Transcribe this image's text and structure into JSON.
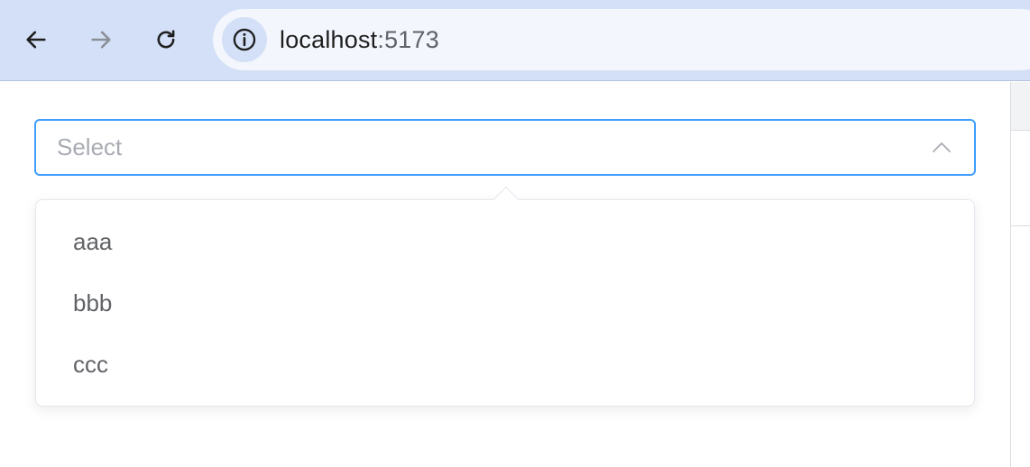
{
  "browser": {
    "url_host": "localhost",
    "url_port": ":5173",
    "icons": {
      "back": "arrow-left-icon",
      "forward": "arrow-right-icon",
      "reload": "reload-icon",
      "site_info": "info-icon"
    }
  },
  "select": {
    "placeholder": "Select",
    "caret_icon": "chevron-up-icon",
    "accent_color": "#409eff"
  },
  "dropdown": {
    "options": [
      {
        "label": "aaa"
      },
      {
        "label": "bbb"
      },
      {
        "label": "ccc"
      }
    ]
  }
}
